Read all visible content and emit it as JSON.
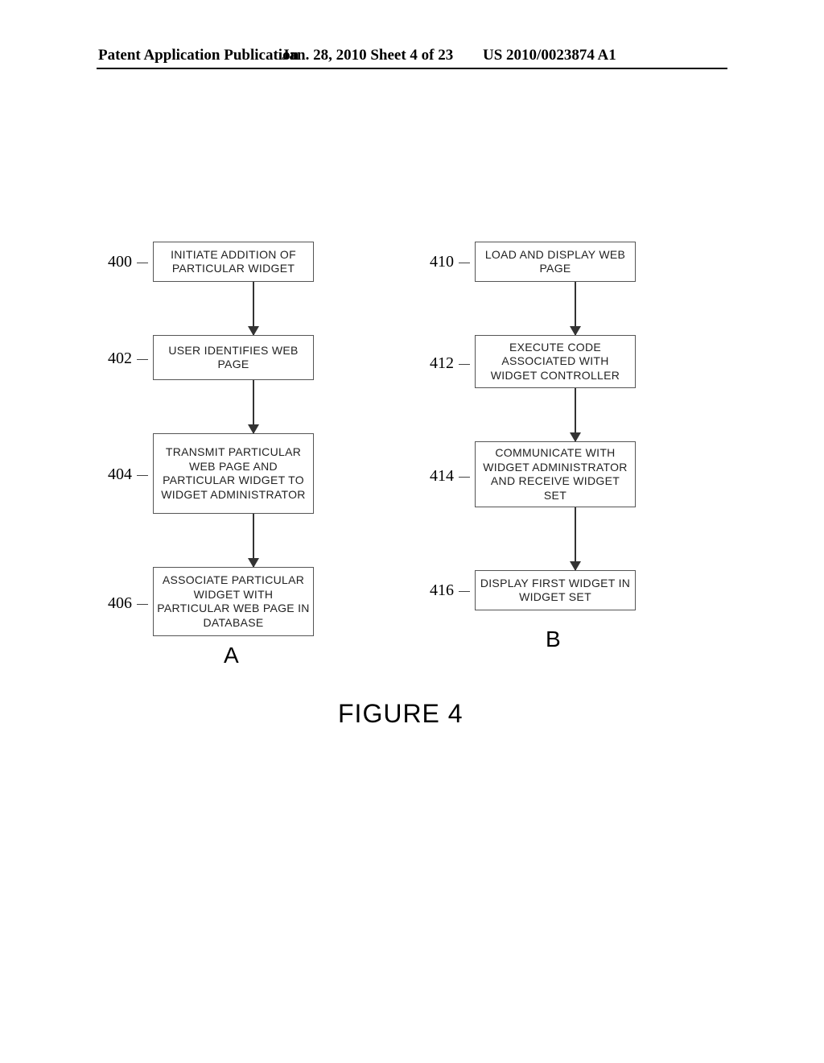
{
  "header": {
    "left": "Patent Application Publication",
    "center": "Jan. 28, 2010  Sheet 4 of 23",
    "right": "US 2010/0023874 A1"
  },
  "flowchart": {
    "columns": {
      "A": {
        "label": "A",
        "steps": [
          {
            "ref": "400",
            "text": "INITIATE ADDITION OF PARTICULAR WIDGET"
          },
          {
            "ref": "402",
            "text": "USER IDENTIFIES WEB PAGE"
          },
          {
            "ref": "404",
            "text": "TRANSMIT PARTICULAR WEB PAGE AND PARTICULAR WIDGET TO WIDGET ADMINISTRATOR"
          },
          {
            "ref": "406",
            "text": "ASSOCIATE PARTICULAR WIDGET WITH PARTICULAR WEB PAGE IN DATABASE"
          }
        ]
      },
      "B": {
        "label": "B",
        "steps": [
          {
            "ref": "410",
            "text": "LOAD AND DISPLAY WEB PAGE"
          },
          {
            "ref": "412",
            "text": "EXECUTE CODE ASSOCIATED WITH WIDGET CONTROLLER"
          },
          {
            "ref": "414",
            "text": "COMMUNICATE WITH WIDGET ADMINISTRATOR AND RECEIVE WIDGET SET"
          },
          {
            "ref": "416",
            "text": "DISPLAY FIRST WIDGET IN WIDGET SET"
          }
        ]
      }
    }
  },
  "figure_caption": "FIGURE 4"
}
